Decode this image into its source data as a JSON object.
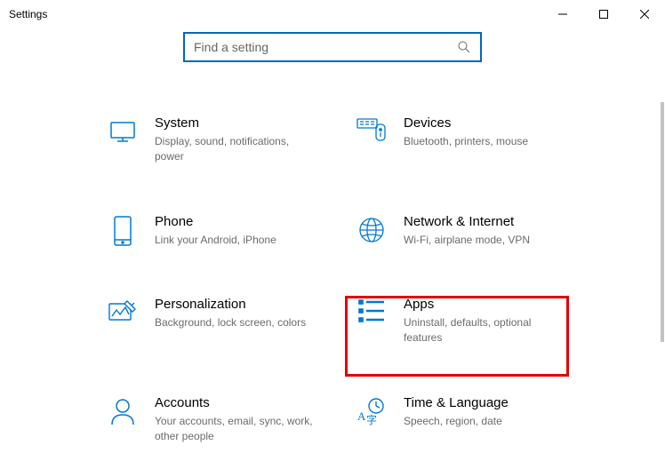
{
  "window": {
    "title": "Settings"
  },
  "search": {
    "placeholder": "Find a setting"
  },
  "categories": {
    "system": {
      "title": "System",
      "desc": "Display, sound, notifications, power"
    },
    "devices": {
      "title": "Devices",
      "desc": "Bluetooth, printers, mouse"
    },
    "phone": {
      "title": "Phone",
      "desc": "Link your Android, iPhone"
    },
    "network": {
      "title": "Network & Internet",
      "desc": "Wi-Fi, airplane mode, VPN"
    },
    "personalization": {
      "title": "Personalization",
      "desc": "Background, lock screen, colors"
    },
    "apps": {
      "title": "Apps",
      "desc": "Uninstall, defaults, optional features"
    },
    "accounts": {
      "title": "Accounts",
      "desc": "Your accounts, email, sync, work, other people"
    },
    "time": {
      "title": "Time & Language",
      "desc": "Speech, region, date"
    }
  },
  "highlight": {
    "target": "apps"
  },
  "colors": {
    "accent": "#0078d4",
    "highlight": "#e40000"
  }
}
